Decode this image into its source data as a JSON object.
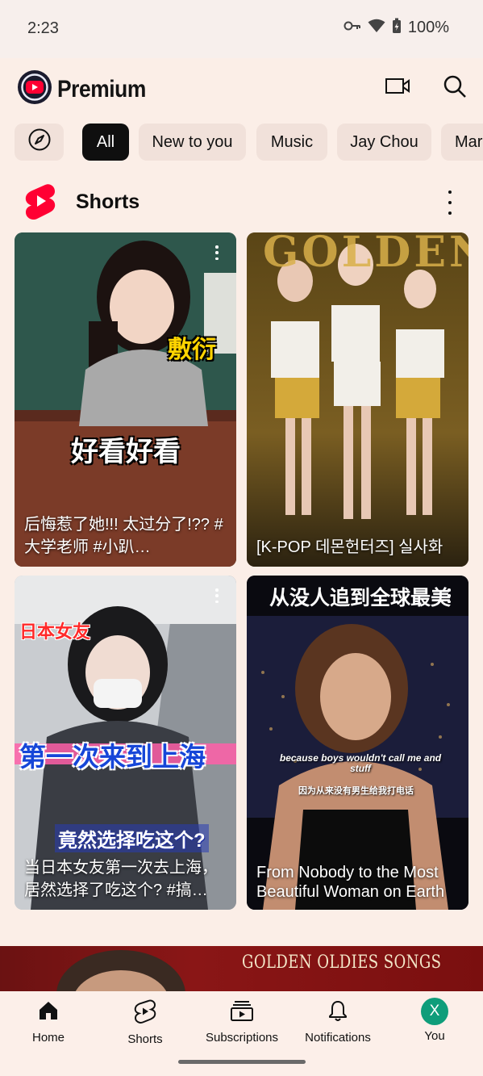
{
  "status": {
    "time": "2:23",
    "battery": "100%"
  },
  "header": {
    "logo_text": "Premium",
    "icons": [
      "cast-video-icon",
      "search-icon"
    ]
  },
  "chips": [
    {
      "icon": "explore-compass-icon"
    },
    {
      "label": "All",
      "active": true
    },
    {
      "label": "New to you"
    },
    {
      "label": "Music"
    },
    {
      "label": "Jay Chou"
    },
    {
      "label": "Mar"
    }
  ],
  "shorts": {
    "title": "Shorts",
    "items": [
      {
        "caption": "后悔惹了她!!! 太过分了!?? #大学老师 #小趴…",
        "overlay_top": "敷衍",
        "overlay_mid": "好看好看"
      },
      {
        "caption": "[K-POP 데몬헌터즈] 실사화",
        "overlay_top": "GOLDEN"
      },
      {
        "caption": "当日本女友第一次去上海，居然选择了吃这个? #搞…",
        "overlay_tag": "日本女友",
        "overlay_mid": "第一次来到上海",
        "overlay_sub": "竟然选择吃这个?"
      },
      {
        "caption": "From Nobody to the Most Beautiful Woman on Earth",
        "overlay_top": "从没人追到全球最美",
        "sub_en": "because boys wouldn't call me and stuff",
        "sub_zh": "因为从来没有男生给我打电话"
      }
    ]
  },
  "banner": {
    "text": "GOLDEN OLDIES SONGS"
  },
  "nav": [
    {
      "label": "Home",
      "icon": "home-icon"
    },
    {
      "label": "Shorts",
      "icon": "shorts-icon"
    },
    {
      "label": "Subscriptions",
      "icon": "subscriptions-icon"
    },
    {
      "label": "Notifications",
      "icon": "bell-icon"
    },
    {
      "label": "You",
      "avatar_letter": "X"
    }
  ],
  "colors": {
    "accent_red": "#ff0033",
    "chip_bg": "#f1e1da",
    "page_bg": "#fbeee7",
    "avatar": "#0f9d7a"
  }
}
